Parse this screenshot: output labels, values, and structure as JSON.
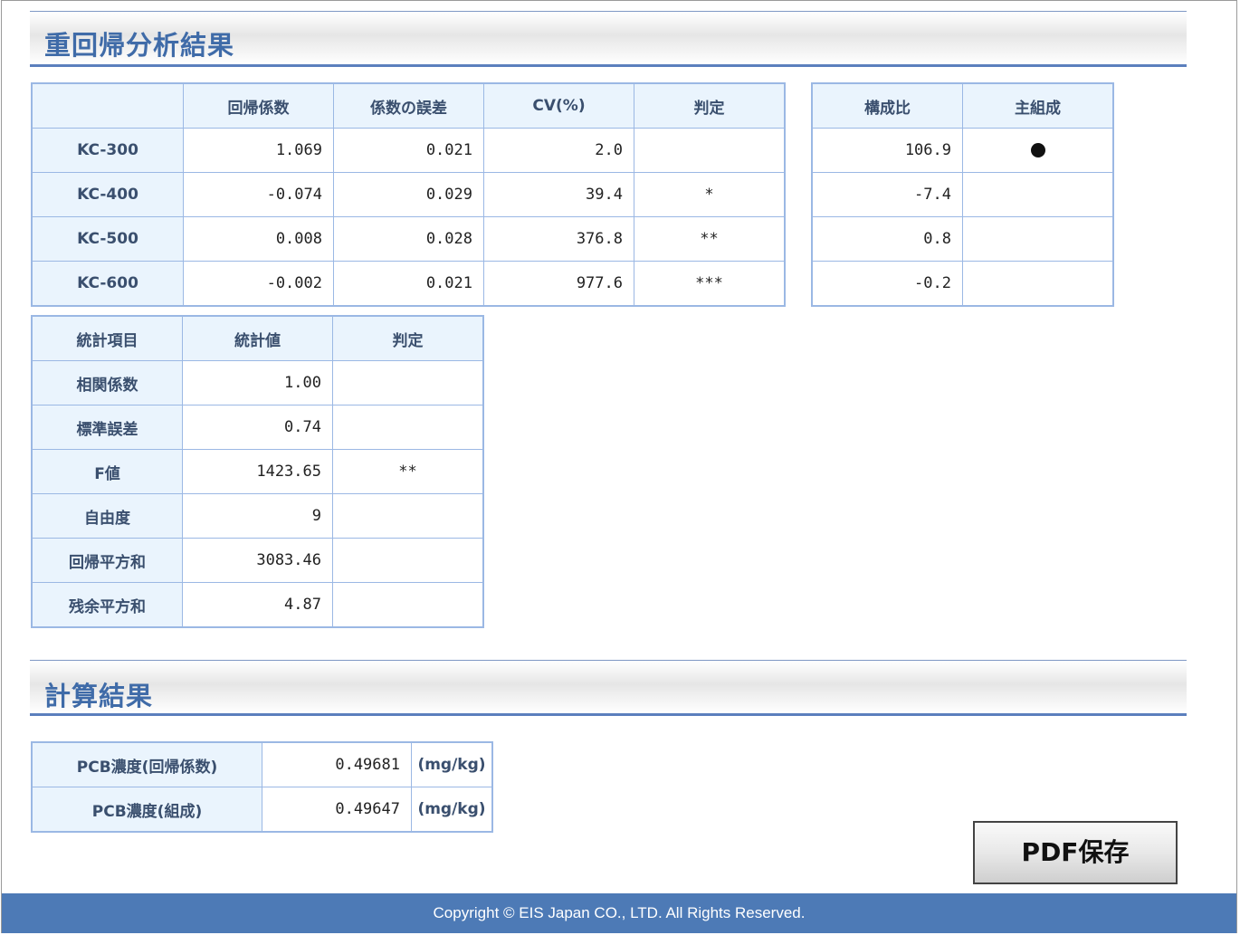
{
  "sections": {
    "regression_title": "重回帰分析結果",
    "calc_title": "計算結果"
  },
  "regression_table": {
    "headers": [
      "",
      "回帰係数",
      "係数の誤差",
      "CV(%)",
      "判定"
    ],
    "rows": [
      {
        "label": "KC-300",
        "coef": "1.069",
        "err": "0.021",
        "cv": "2.0",
        "judge": ""
      },
      {
        "label": "KC-400",
        "coef": "-0.074",
        "err": "0.029",
        "cv": "39.4",
        "judge": "*"
      },
      {
        "label": "KC-500",
        "coef": "0.008",
        "err": "0.028",
        "cv": "376.8",
        "judge": "**"
      },
      {
        "label": "KC-600",
        "coef": "-0.002",
        "err": "0.021",
        "cv": "977.6",
        "judge": "***"
      }
    ]
  },
  "ratio_table": {
    "headers": [
      "構成比",
      "主組成"
    ],
    "rows": [
      {
        "ratio": "106.9",
        "main": true
      },
      {
        "ratio": "-7.4",
        "main": false
      },
      {
        "ratio": "0.8",
        "main": false
      },
      {
        "ratio": "-0.2",
        "main": false
      }
    ]
  },
  "stats_table": {
    "headers": [
      "統計項目",
      "統計値",
      "判定"
    ],
    "rows": [
      {
        "label": "相関係数",
        "value": "1.00",
        "judge": ""
      },
      {
        "label": "標準誤差",
        "value": "0.74",
        "judge": ""
      },
      {
        "label": "F値",
        "value": "1423.65",
        "judge": "**"
      },
      {
        "label": "自由度",
        "value": "9",
        "judge": ""
      },
      {
        "label": "回帰平方和",
        "value": "3083.46",
        "judge": ""
      },
      {
        "label": "残余平方和",
        "value": "4.87",
        "judge": ""
      }
    ]
  },
  "calc_table": {
    "rows": [
      {
        "label": "PCB濃度(回帰係数)",
        "value": "0.49681",
        "unit": "(mg/kg)"
      },
      {
        "label": "PCB濃度(組成)",
        "value": "0.49647",
        "unit": "(mg/kg)"
      }
    ]
  },
  "buttons": {
    "pdf_save": "PDF保存"
  },
  "footer": {
    "copyright": "Copyright © EIS Japan CO., LTD. All Rights Reserved."
  },
  "colors": {
    "header_blue": "#3f6ba8",
    "cell_header_bg": "#eaf4fd",
    "border": "#9bb8e4",
    "footer_bg": "#4d7ab6"
  }
}
